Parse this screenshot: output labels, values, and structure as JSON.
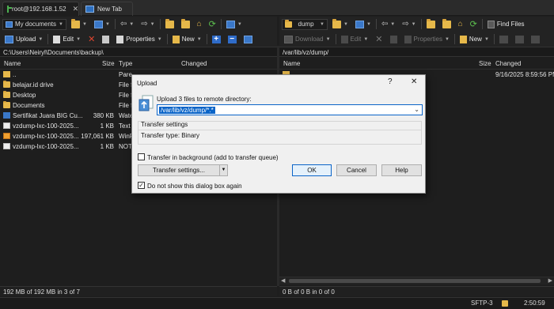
{
  "tabs": [
    {
      "label": "root@192.168.1.52",
      "active": true,
      "icon": "terminal-icon"
    },
    {
      "label": "New Tab",
      "active": false,
      "icon": "window-icon"
    }
  ],
  "left": {
    "location": "My documents",
    "toolbar": {
      "upload": "Upload",
      "edit": "Edit",
      "properties": "Properties",
      "new": "New"
    },
    "path": "C:\\Users\\Neiryl\\Documents\\backup\\",
    "columns": {
      "name": "Name",
      "size": "Size",
      "type": "Type",
      "changed": "Changed"
    },
    "files": [
      {
        "icon": "parent-dir-icon",
        "name": "..",
        "size": "",
        "type": "Pare",
        "changed": ""
      },
      {
        "icon": "folder-icon",
        "name": "belajar.id drive",
        "size": "",
        "type": "File f",
        "changed": ""
      },
      {
        "icon": "folder-icon",
        "name": "Desktop",
        "size": "",
        "type": "File f",
        "changed": ""
      },
      {
        "icon": "folder-icon",
        "name": "Documents",
        "size": "",
        "type": "File f",
        "changed": ""
      },
      {
        "icon": "certificate-file-icon",
        "name": "Sertifikat Juara BIG Cu...",
        "size": "380 KB",
        "type": "Wate",
        "changed": ""
      },
      {
        "icon": "document-file-icon",
        "name": "vzdump-lxc-100-2025...",
        "size": "1 KB",
        "type": "Text",
        "changed": ""
      },
      {
        "icon": "archive-file-icon",
        "name": "vzdump-lxc-100-2025...",
        "size": "197,061 KB",
        "type": "WinR",
        "changed": ""
      },
      {
        "icon": "document-file-icon",
        "name": "vzdump-lxc-100-2025...",
        "size": "1 KB",
        "type": "NOT",
        "changed": ""
      }
    ],
    "status": "192 MB of 192 MB in 3 of 7"
  },
  "right": {
    "location": "dump",
    "find_files": "Find Files",
    "toolbar": {
      "download": "Download",
      "edit": "Edit",
      "properties": "Properties",
      "new": "New"
    },
    "path": "/var/lib/vz/dump/",
    "columns": {
      "name": "Name",
      "size": "Size",
      "changed": "Changed"
    },
    "files": [
      {
        "icon": "parent-dir-icon",
        "name": "",
        "size": "",
        "changed": "9/16/2025 8:59:56 PM"
      }
    ],
    "status": "0 B of 0 B in 0 of 0"
  },
  "bottom": {
    "protocol": "SFTP-3",
    "time": "2:50:59"
  },
  "dialog": {
    "title": "Upload",
    "help_glyph": "?",
    "close_glyph": "✕",
    "prompt": "Upload 3 files to remote directory:",
    "target": "/var/lib/vz/dump/*.*",
    "settings_heading": "Transfer settings",
    "transfer_type": "Transfer type: Binary",
    "background_label": "Transfer in background (add to transfer queue)",
    "background_checked": false,
    "settings_button": "Transfer settings...",
    "ok": "OK",
    "cancel": "Cancel",
    "help": "Help",
    "dont_show_label": "Do not show this dialog box again",
    "dont_show_checked": true
  }
}
